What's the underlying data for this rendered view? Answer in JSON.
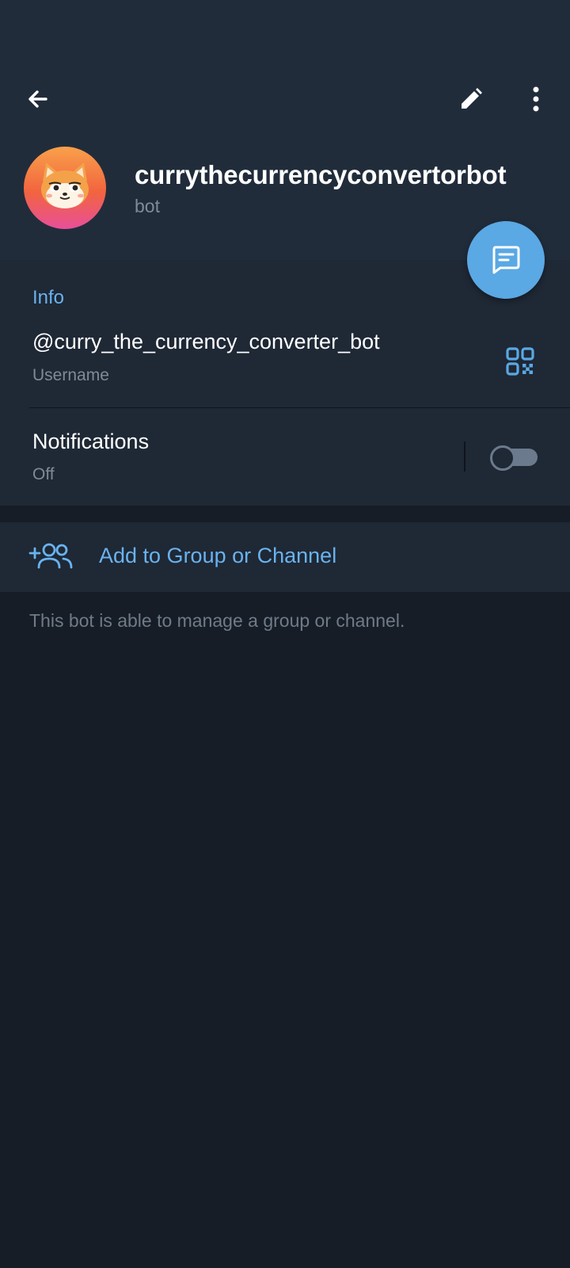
{
  "profile": {
    "name": "currythecurrencyconvertorbot",
    "subtitle": "bot",
    "avatar_colors": {
      "top": "#f9a14a",
      "bottom": "#e84f9a"
    }
  },
  "toolbar": {
    "back_icon": "arrow-left-icon",
    "edit_icon": "pencil-icon",
    "more_icon": "more-vertical-icon"
  },
  "fab": {
    "icon": "message-icon",
    "color": "#5aa8e4"
  },
  "info": {
    "title": "Info",
    "username": {
      "value": "@curry_the_currency_converter_bot",
      "label": "Username",
      "icon": "qr-code-icon"
    },
    "notifications": {
      "label": "Notifications",
      "value": "Off",
      "enabled": false
    }
  },
  "actions": {
    "add_to_group": {
      "label": "Add to Group or Channel",
      "icon": "add-user-group-icon"
    }
  },
  "footer": {
    "note": "This bot is able to manage a group or channel."
  },
  "colors": {
    "accent": "#69b3ef",
    "background": "#171d26",
    "header": "#212c3b",
    "card": "#1f2835"
  }
}
